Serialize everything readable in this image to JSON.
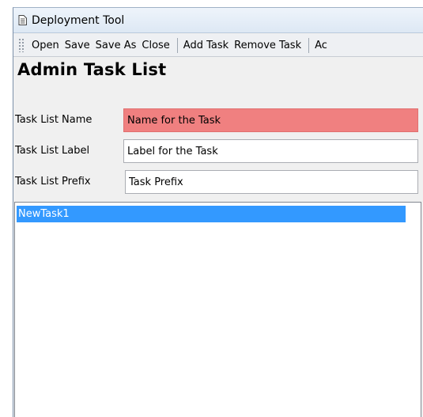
{
  "window": {
    "title": "Deployment Tool",
    "icon": "document-icon"
  },
  "toolbar": {
    "items": [
      {
        "label": "Open"
      },
      {
        "label": "Save"
      },
      {
        "label": "Save As"
      },
      {
        "label": "Close"
      },
      {
        "label": "Add Task"
      },
      {
        "label": "Remove Task"
      },
      {
        "label": "Ac"
      }
    ]
  },
  "page": {
    "title": "Admin Task List"
  },
  "form": {
    "name_label": "Task List Name",
    "name_value": "Name for the Task",
    "name_state": "invalid",
    "label_label": "Task List Label",
    "label_value": "Label for the Task",
    "prefix_label": "Task List Prefix",
    "prefix_value": "Task Prefix"
  },
  "task_list": {
    "items": [
      "NewTask1"
    ],
    "selected_index": 0
  },
  "colors": {
    "invalid_field": "#f08080",
    "selection": "#3399ff"
  }
}
